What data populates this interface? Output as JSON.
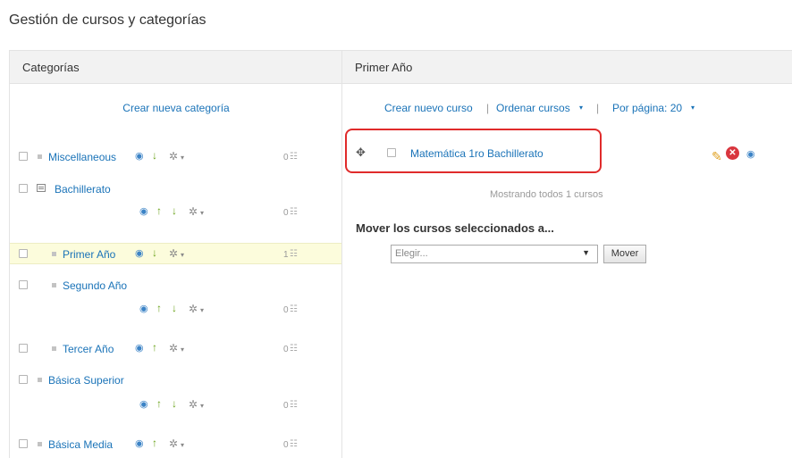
{
  "page": {
    "title": "Gestión de cursos y categorías"
  },
  "categories_panel": {
    "header": "Categorías",
    "create_link": "Crear nueva categoría",
    "items": [
      {
        "label": "Miscellaneous",
        "count": "0",
        "icons": [
          "eye-icon",
          "arrow-down-icon",
          "gear-icon"
        ]
      },
      {
        "label": "Bachillerato",
        "count": "0",
        "icons": [
          "eye-icon",
          "arrow-up-icon",
          "arrow-down-icon",
          "gear-icon"
        ]
      },
      {
        "label": "Primer Año",
        "count": "1",
        "selected": true,
        "icons": [
          "eye-icon",
          "arrow-down-icon",
          "gear-icon"
        ]
      },
      {
        "label": "Segundo Año",
        "count": "0",
        "icons": [
          "eye-icon",
          "arrow-up-icon",
          "arrow-down-icon",
          "gear-icon"
        ]
      },
      {
        "label": "Tercer Año",
        "count": "0",
        "icons": [
          "eye-icon",
          "arrow-up-icon",
          "gear-icon"
        ]
      },
      {
        "label": "Básica Superior",
        "count": "0",
        "icons": [
          "eye-icon",
          "arrow-up-icon",
          "arrow-down-icon",
          "gear-icon"
        ]
      },
      {
        "label": "Básica Media",
        "count": "0",
        "icons": [
          "eye-icon",
          "arrow-up-icon",
          "gear-icon"
        ]
      }
    ]
  },
  "courses_panel": {
    "header": "Primer Año",
    "create_course": "Crear nuevo curso",
    "sort_courses": "Ordenar cursos",
    "per_page": "Por página: 20",
    "courses": [
      {
        "name": "Matemática 1ro Bachillerato"
      }
    ],
    "showing_text": "Mostrando todos 1 cursos",
    "move_label": "Mover los cursos seleccionados a...",
    "select_placeholder": "Elegir...",
    "move_button": "Mover"
  },
  "colors": {
    "link": "#1a73b8",
    "highlight_border": "#e02b2b",
    "selected_row": "#fcfcdc"
  }
}
